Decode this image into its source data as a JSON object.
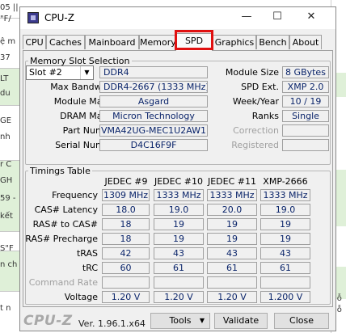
{
  "window": {
    "title": "CPU-Z"
  },
  "titlebar": {
    "minimize": "—",
    "maximize": "☐",
    "close": "✕"
  },
  "tabs": [
    "CPU",
    "Caches",
    "Mainboard",
    "Memory",
    "SPD",
    "Graphics",
    "Bench",
    "About"
  ],
  "active_tab": "SPD",
  "memory_slot": {
    "legend": "Memory Slot Selection",
    "slot": "Slot #2",
    "type": "DDR4",
    "max_bandwidth_label": "Max Bandwidth",
    "max_bandwidth": "DDR4-2667 (1333 MHz)",
    "module_manuf_label": "Module Manuf.",
    "module_manuf": "Asgard",
    "dram_manuf_label": "DRAM Manuf.",
    "dram_manuf": "Micron Technology",
    "part_number_label": "Part Number",
    "part_number": "VMA42UG-MEC1U2AW1",
    "serial_number_label": "Serial Number",
    "serial_number": "D4C16F9F",
    "module_size_label": "Module Size",
    "module_size": "8 GBytes",
    "spd_ext_label": "SPD Ext.",
    "spd_ext": "XMP 2.0",
    "week_year_label": "Week/Year",
    "week_year": "10 / 19",
    "ranks_label": "Ranks",
    "ranks": "Single",
    "correction_label": "Correction",
    "registered_label": "Registered"
  },
  "timings": {
    "legend": "Timings Table",
    "columns": [
      "JEDEC #9",
      "JEDEC #10",
      "JEDEC #11",
      "XMP-2666"
    ],
    "rows": [
      {
        "label": "Frequency",
        "values": [
          "1309 MHz",
          "1333 MHz",
          "1333 MHz",
          "1333 MHz"
        ]
      },
      {
        "label": "CAS# Latency",
        "values": [
          "18.0",
          "19.0",
          "20.0",
          "19.0"
        ]
      },
      {
        "label": "RAS# to CAS#",
        "values": [
          "18",
          "19",
          "19",
          "19"
        ]
      },
      {
        "label": "RAS# Precharge",
        "values": [
          "18",
          "19",
          "19",
          "19"
        ]
      },
      {
        "label": "tRAS",
        "values": [
          "42",
          "43",
          "43",
          "43"
        ]
      },
      {
        "label": "tRC",
        "values": [
          "60",
          "61",
          "61",
          "61"
        ]
      },
      {
        "label": "Command Rate",
        "values": [
          "",
          "",
          "",
          ""
        ]
      },
      {
        "label": "Voltage",
        "values": [
          "1.20 V",
          "1.20 V",
          "1.20 V",
          "1.200 V"
        ]
      }
    ]
  },
  "footer": {
    "logo": "CPU-Z",
    "version": "Ver. 1.96.1.x64",
    "tools": "Tools",
    "validate": "Validate",
    "close": "Close"
  },
  "background": {
    "left_fragments": [
      "05 ||",
      "\"F/",
      "ệ m",
      "37",
      "LT",
      "du",
      "GE",
      "nh",
      "r C",
      "GH",
      "59 -",
      "kết",
      "S\"F",
      "n ch",
      "t n"
    ],
    "right_fragments": [
      "lỗ",
      "lỗ"
    ]
  },
  "colors": {
    "value_text": "#0a246a",
    "tab_highlight": "#e01010",
    "logo": "#a8a8a8"
  }
}
